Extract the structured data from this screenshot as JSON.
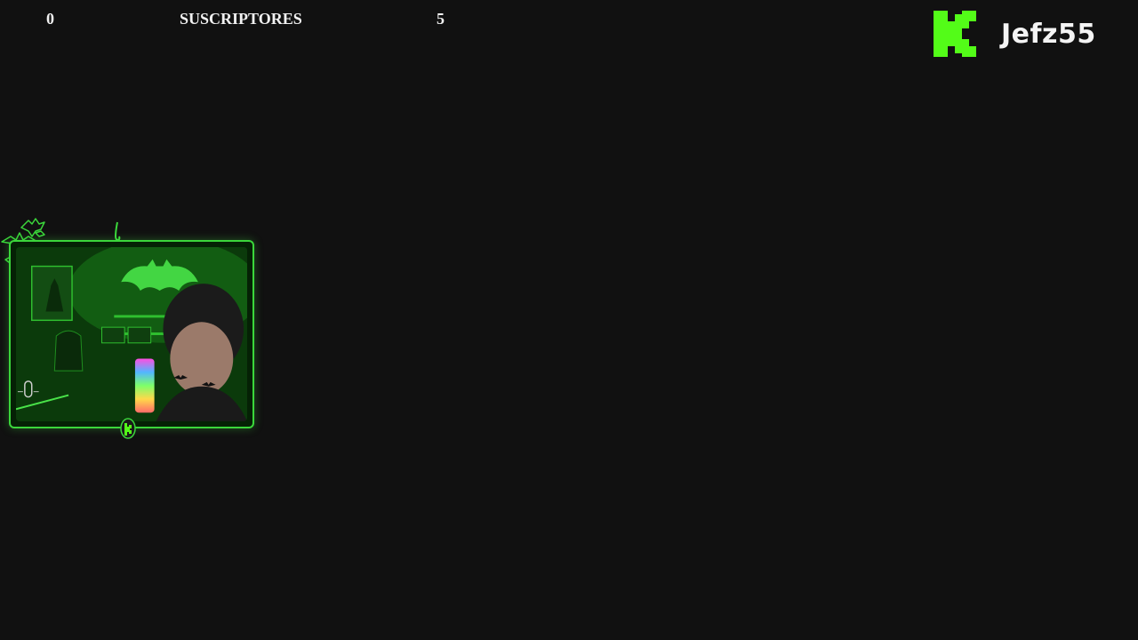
{
  "stats": {
    "left_count": "0",
    "label": "SUSCRIPTORES",
    "right_count": "5"
  },
  "brand": {
    "logo_letter": "K",
    "logo_icon": "kick-logo-icon",
    "name": "Jefz55",
    "accent_color": "#53fc18"
  },
  "webcam": {
    "frame_color": "#3bd63b",
    "badge_icon": "kick-badge-icon",
    "decoration_icon": "bat-decoration-icon"
  }
}
